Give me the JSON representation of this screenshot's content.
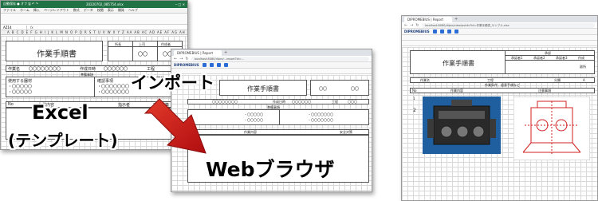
{
  "excel": {
    "title_left": "自動保存 ● オフ 🖫 ↶ ↷",
    "title_file": "20220702_085754.xlsx",
    "title_right": "─ □ ✕",
    "tabs": [
      "ファイル",
      "ホーム",
      "挿入",
      "ページレイアウト",
      "数式",
      "データ",
      "校閲",
      "表示",
      "開発",
      "ヘルプ"
    ],
    "name_box": "AZ14",
    "fx": "fx",
    "col_header": "A B C D E F G H I J K L M N O P Q R S T U V W X Y Z AA AB AC AD AE AF AG AH AI AJ AK",
    "sheet": {
      "title": "作業手順書",
      "sig_headers": [
        "所長",
        "上司",
        "作成者"
      ],
      "sig_marks": [
        "〇〇",
        "〇〇"
      ],
      "row1_label": "作業名",
      "row1_value": "〇〇〇〇〇〇〇〇",
      "row1_label2": "作成日時",
      "row1_value2": "〇〇〇〇〇〇",
      "row1_label3": "工程",
      "prep_header": "準備事項",
      "tools_label": "使用する器材",
      "tools_items": [
        "・〇〇〇〇〇",
        "・〇〇〇〇〇"
      ],
      "confirm_label": "確認事項",
      "confirm_items": [
        "・〇〇〇〇〇〇〇",
        "・〇〇〇〇〇〇〇"
      ],
      "row_no": "No",
      "work_label": "作業内容",
      "work_label2": "指示者",
      "work_label3": "安全対策"
    }
  },
  "browser_mid": {
    "tab_label": "DIPROMEBIUS | Report",
    "url": "localhost:8080/dipro/...report?id=...",
    "app_name": "DIPROMEBIUS",
    "sheet_title": "作業手順書",
    "cells": [
      "〇〇〇〇〇〇〇〇",
      "作成日時",
      "〇〇〇〇〇〇",
      "工程",
      "〇〇〇"
    ],
    "prep_header": "準備事項",
    "tools_items": [
      "・〇〇〇〇〇",
      "・〇〇〇〇〇"
    ],
    "confirm_items": [
      "・〇〇〇〇〇〇〇",
      "・〇〇〇〇〇〇〇"
    ],
    "work_header": "作業内容",
    "safety_header": "安全対策",
    "sig_marks": [
      "〇〇",
      "〇〇"
    ]
  },
  "browser_right": {
    "tab_label": "DIPROMEBIUS | Report",
    "url": "localhost:8080/dipro/view/public?id=作業手順書_サンプル.xlsx",
    "app_name": "DIPROMEBIUS",
    "sheet_title": "作業手順書",
    "top_header": "承認",
    "approval_cols": [
      "承認者1",
      "承認者2",
      "承認者3",
      "作成"
    ],
    "approval_value": "副所",
    "row1": [
      "作業名",
      "工程",
      "分類",
      "A"
    ],
    "section_header": "作業条件、留意手順など",
    "work_header": "作業内容",
    "notes_header": "注意事項",
    "row_no": "No",
    "row_nums": [
      "1",
      "2"
    ]
  },
  "labels": {
    "excel": "Excel",
    "template": "(テンプレート)",
    "import": "インポート",
    "web": "Webブラウザ"
  },
  "colors": {
    "excel_green": "#217346",
    "arrow_red": "#d01818",
    "image_bg": "#1f5fa0"
  },
  "icons": [
    "reload-icon",
    "back-icon",
    "forward-icon",
    "arrow-icon",
    "engine-photo",
    "cad-drawing"
  ]
}
